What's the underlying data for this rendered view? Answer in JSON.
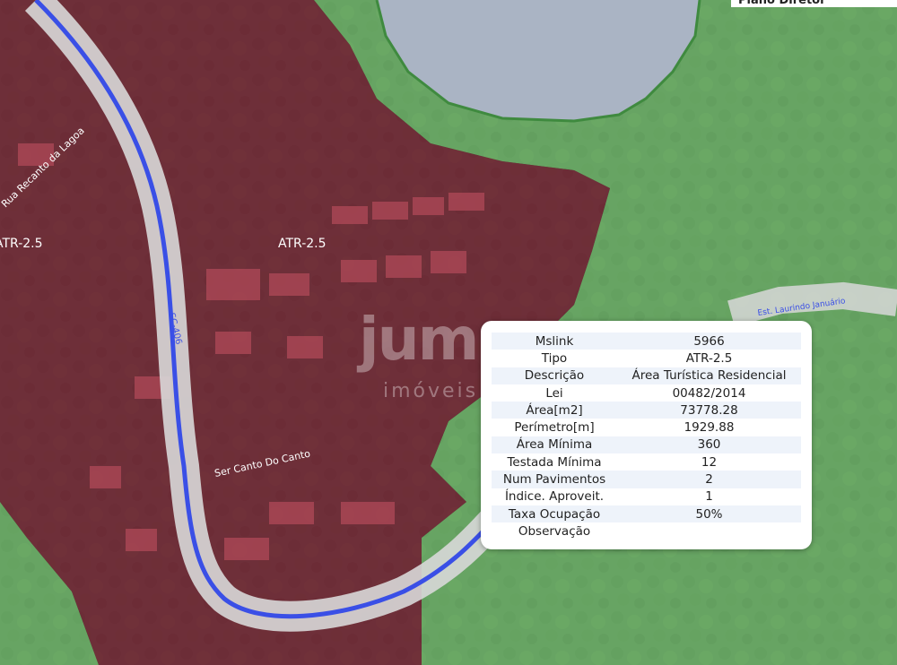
{
  "header": {
    "layer_title": "Plano Diretor"
  },
  "map": {
    "zone_labels": [
      "ATR-2.5",
      "ATR-2.5"
    ],
    "street_labels": [
      "Rua Recanto da Lagoa",
      "Ser Canto Do Canto",
      "Est. Laurindo Januário",
      "SC-406"
    ],
    "watermark": "jump",
    "watermark_sub": "imóveis",
    "colors": {
      "atr_zone": "#7a2a3c",
      "green_zone": "#78c878",
      "lagoon": "#aab4c4",
      "road": "#d8d8d8",
      "route_line": "#3a4fe6"
    }
  },
  "popup": {
    "rows": [
      {
        "key": "Mslink",
        "value": "5966"
      },
      {
        "key": "Tipo",
        "value": "ATR-2.5"
      },
      {
        "key": "Descrição",
        "value": "Área Turística Residencial"
      },
      {
        "key": "Lei",
        "value": "00482/2014"
      },
      {
        "key": "Área[m2]",
        "value": "73778.28"
      },
      {
        "key": "Perímetro[m]",
        "value": "1929.88"
      },
      {
        "key": "Área Mínima",
        "value": "360"
      },
      {
        "key": "Testada Mínima",
        "value": "12"
      },
      {
        "key": "Num Pavimentos",
        "value": "2"
      },
      {
        "key": "Índice. Aproveit.",
        "value": "1"
      },
      {
        "key": "Taxa Ocupação",
        "value": "50%"
      },
      {
        "key": "Observação",
        "value": ""
      }
    ]
  }
}
